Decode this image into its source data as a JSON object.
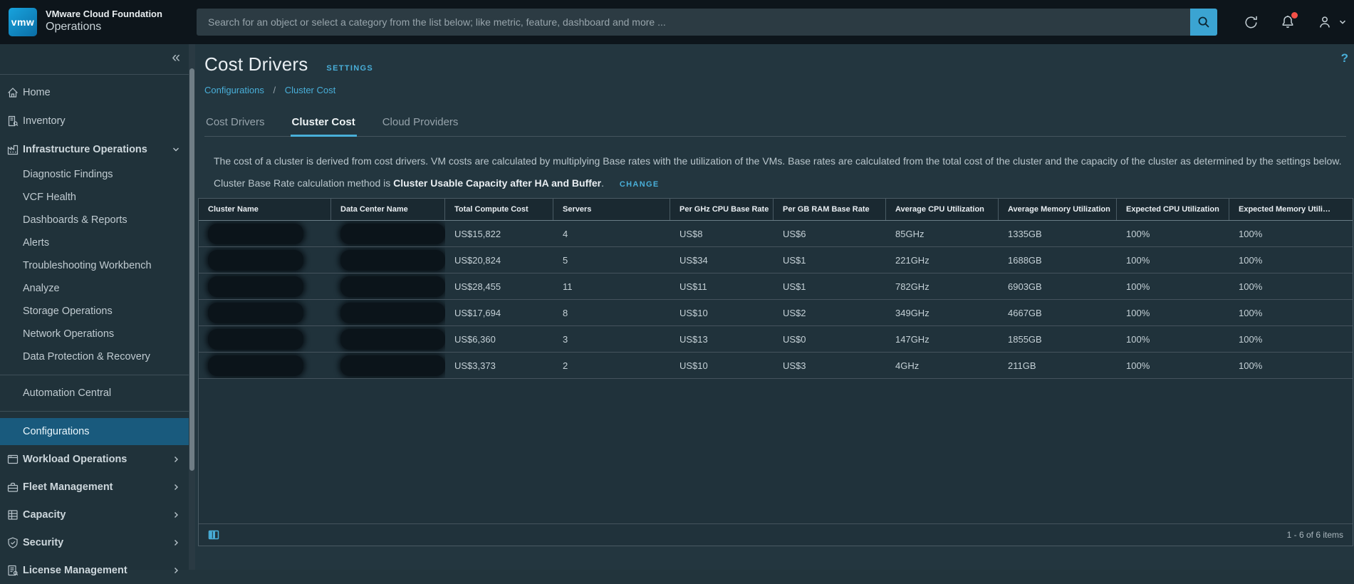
{
  "header": {
    "logo": "vmw",
    "product": "VMware Cloud Foundation",
    "suite": "Operations",
    "search_placeholder": "Search for an object or select a category from the list below; like metric, feature, dashboard and more ...",
    "icons": {
      "search": "search-icon",
      "refresh": "refresh-icon",
      "notifications": "bell-icon",
      "user": "user-icon",
      "user_menu": "chevron-down-icon"
    }
  },
  "sidebar": {
    "collapse_glyph": "«",
    "items": [
      {
        "label": "Home",
        "icon": "home",
        "type": "top"
      },
      {
        "label": "Inventory",
        "icon": "inventory",
        "type": "top"
      },
      {
        "label": "Infrastructure Operations",
        "icon": "infrastructure",
        "type": "group",
        "chevron": "down"
      },
      {
        "label": "Diagnostic Findings",
        "type": "sub"
      },
      {
        "label": "VCF Health",
        "type": "sub"
      },
      {
        "label": "Dashboards & Reports",
        "type": "sub"
      },
      {
        "label": "Alerts",
        "type": "sub"
      },
      {
        "label": "Troubleshooting Workbench",
        "type": "sub"
      },
      {
        "label": "Analyze",
        "type": "sub"
      },
      {
        "label": "Storage Operations",
        "type": "sub"
      },
      {
        "label": "Network Operations",
        "type": "sub"
      },
      {
        "label": "Data Protection & Recovery",
        "type": "sub"
      },
      {
        "type": "divider"
      },
      {
        "label": "Automation Central",
        "type": "sub"
      },
      {
        "type": "divider"
      },
      {
        "label": "Configurations",
        "type": "sub",
        "active": true
      },
      {
        "label": "Workload Operations",
        "icon": "workload",
        "type": "group",
        "chevron": "right"
      },
      {
        "label": "Fleet Management",
        "icon": "fleet",
        "type": "group",
        "chevron": "right"
      },
      {
        "label": "Capacity",
        "icon": "capacity",
        "type": "group",
        "chevron": "right"
      },
      {
        "label": "Security",
        "icon": "security",
        "type": "group",
        "chevron": "right"
      },
      {
        "label": "License Management",
        "icon": "license",
        "type": "group",
        "chevron": "right"
      }
    ]
  },
  "page": {
    "title": "Cost Drivers",
    "settings_label": "SETTINGS",
    "help_label": "?",
    "breadcrumb": {
      "items": [
        "Configurations",
        "Cluster Cost"
      ],
      "separator": "/"
    },
    "tabs": [
      {
        "label": "Cost Drivers",
        "active": false
      },
      {
        "label": "Cluster Cost",
        "active": true
      },
      {
        "label": "Cloud Providers",
        "active": false
      }
    ],
    "description": "The cost of a cluster is derived from cost drivers. VM costs are calculated by multiplying Base rates with the utilization of the VMs. Base rates are calculated from the total cost of the cluster and the capacity of the cluster as determined by the settings below.",
    "method_prefix": "Cluster Base Rate calculation method is",
    "method_value": "Cluster Usable Capacity after HA and Buffer",
    "method_suffix": ".",
    "change_label": "CHANGE"
  },
  "table": {
    "columns": [
      "Cluster Name",
      "Data Center Name",
      "Total Compute Cost",
      "Servers",
      "Per GHz CPU Base Rate",
      "Per GB RAM Base Rate",
      "Average CPU Utilization",
      "Average Memory Utilization",
      "Expected CPU Utilization",
      "Expected Memory Utilization"
    ],
    "redacted_note": "cluster and data center names are redacted in the screenshot",
    "rows": [
      [
        null,
        null,
        "US$15,822",
        "4",
        "US$8",
        "US$6",
        "85GHz",
        "1335GB",
        "100%",
        "100%"
      ],
      [
        null,
        null,
        "US$20,824",
        "5",
        "US$34",
        "US$1",
        "221GHz",
        "1688GB",
        "100%",
        "100%"
      ],
      [
        null,
        null,
        "US$28,455",
        "11",
        "US$11",
        "US$1",
        "782GHz",
        "6903GB",
        "100%",
        "100%"
      ],
      [
        null,
        null,
        "US$17,694",
        "8",
        "US$10",
        "US$2",
        "349GHz",
        "4667GB",
        "100%",
        "100%"
      ],
      [
        null,
        null,
        "US$6,360",
        "3",
        "US$13",
        "US$0",
        "147GHz",
        "1855GB",
        "100%",
        "100%"
      ],
      [
        null,
        null,
        "US$3,373",
        "2",
        "US$10",
        "US$3",
        "4GHz",
        "211GB",
        "100%",
        "100%"
      ]
    ],
    "pagination": "1 - 6 of 6 items"
  },
  "colors": {
    "accent_blue": "#49afd9",
    "selected_nav": "#195a7d",
    "notification_dot": "#f55047",
    "search_button": "#3ba4d2",
    "topbar_bg": "#0d151b",
    "content_bg": "#23363f",
    "table_header_bg": "#1a2931"
  }
}
